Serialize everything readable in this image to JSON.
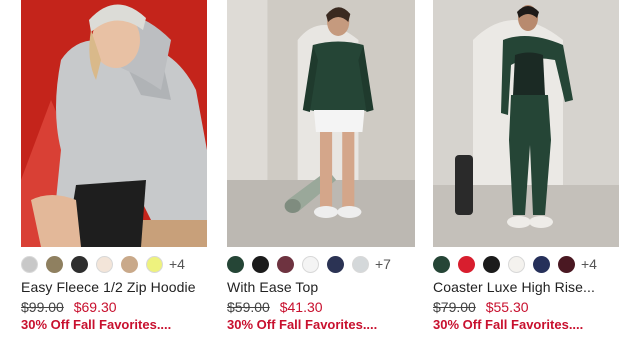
{
  "products": [
    {
      "name": "Easy Fleece 1/2 Zip Hoodie",
      "original_price": "$99.00",
      "sale_price": "$69.30",
      "promo": "30% Off Fall Favorites....",
      "swatches": [
        "#c8c8c8",
        "#8f8060",
        "#2e2e2e",
        "#f3e5d9",
        "#c9a98a",
        "#eef27e"
      ],
      "more_colors": "+4",
      "photo_bg": "#c8261c"
    },
    {
      "name": "With Ease Top",
      "original_price": "$59.00",
      "sale_price": "$41.30",
      "promo": "30% Off Fall Favorites....",
      "swatches": [
        "#254536",
        "#1b1b1b",
        "#6e3340",
        "#f4f4f4",
        "#2b3354",
        "#d4d8da"
      ],
      "more_colors": "+7",
      "photo_bg": "#dedbd6"
    },
    {
      "name": "Coaster Luxe High Rise...",
      "original_price": "$79.00",
      "sale_price": "$55.30",
      "promo": "30% Off Fall Favorites....",
      "swatches": [
        "#254536",
        "#d81e2e",
        "#1b1b1b",
        "#f4f2ee",
        "#26305a",
        "#4a1822"
      ],
      "more_colors": "+4",
      "photo_bg": "#e2e0dc"
    }
  ]
}
